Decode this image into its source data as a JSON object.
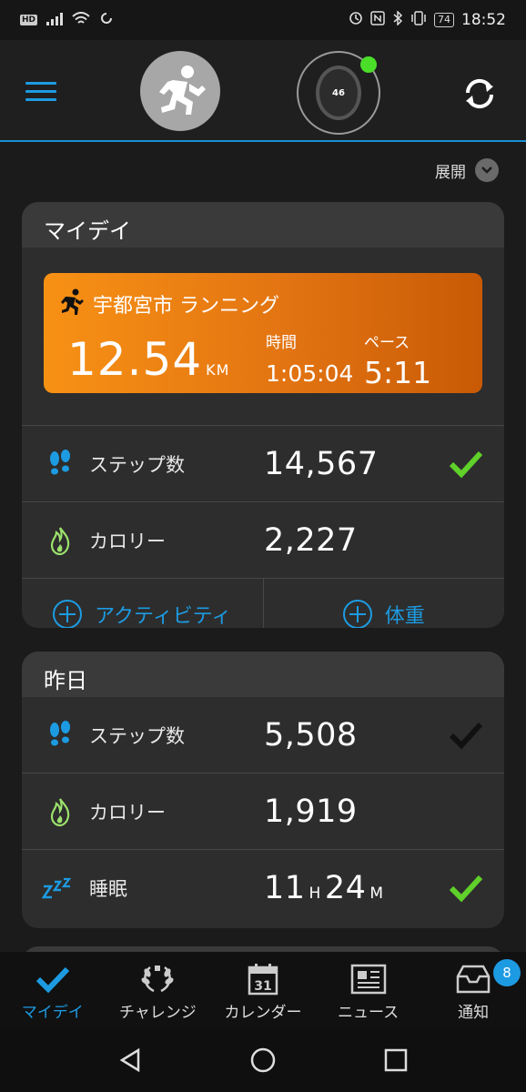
{
  "status_bar": {
    "hd": "HD",
    "battery": "74",
    "time": "18:52"
  },
  "header": {
    "menu_icon": "hamburger-menu-icon",
    "avatar_icon": "runner-avatar-icon",
    "watch_face_text": "46",
    "sync_icon": "sync-icon",
    "status_color": "#4ade29"
  },
  "expand": {
    "label": "展開"
  },
  "my_day": {
    "title": "マイデイ",
    "activity": {
      "title": "宇都宮市 ランニング",
      "distance": "12.54",
      "distance_unit": "KM",
      "time_label": "時間",
      "time_value": "1:05:04",
      "pace_label": "ペース",
      "pace_value": "5:11"
    },
    "rows": [
      {
        "label": "ステップ数",
        "value": "14,567",
        "icon": "footsteps-icon",
        "check": "green"
      },
      {
        "label": "カロリー",
        "value": "2,227",
        "icon": "flame-icon",
        "check": "none"
      }
    ],
    "add_activity": "アクティビティ",
    "add_weight": "体重"
  },
  "yesterday": {
    "title": "昨日",
    "rows": [
      {
        "label": "ステップ数",
        "value": "5,508",
        "icon": "footsteps-icon",
        "check": "dark"
      },
      {
        "label": "カロリー",
        "value": "1,919",
        "icon": "flame-icon",
        "check": "none"
      }
    ],
    "sleep": {
      "label": "睡眠",
      "hours": "11",
      "hours_unit": "H",
      "minutes": "24",
      "minutes_unit": "M",
      "icon": "sleep-zzz-icon",
      "check": "green"
    }
  },
  "bottom_nav": {
    "items": [
      {
        "label": "マイデイ",
        "icon": "checkmark-icon",
        "active": true
      },
      {
        "label": "チャレンジ",
        "icon": "laurel-wreath-icon",
        "active": false
      },
      {
        "label": "カレンダー",
        "icon": "calendar-icon",
        "calendar_day": "31",
        "active": false
      },
      {
        "label": "ニュース",
        "icon": "newspaper-icon",
        "active": false
      },
      {
        "label": "通知",
        "icon": "inbox-icon",
        "badge": "8",
        "active": false
      }
    ]
  },
  "colors": {
    "accent_blue": "#1d9be2",
    "check_green": "#5fd12a",
    "activity_orange": "#f79114"
  }
}
